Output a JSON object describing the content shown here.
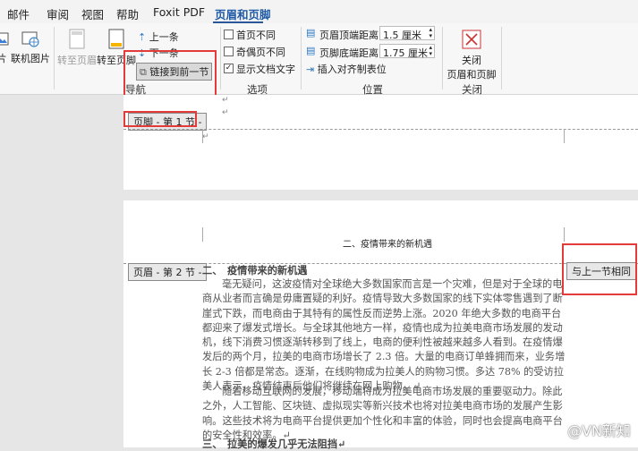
{
  "tabs": [
    "邮件",
    "审阅",
    "视图",
    "帮助",
    "Foxit PDF",
    "页眉和页脚"
  ],
  "ribbon": {
    "left_partial_1": "片",
    "left_partial_2": "联机图片",
    "goto_header": "转至页眉",
    "goto_footer": "转至页脚",
    "prev": "上一条",
    "next": "下一条",
    "link_prev": "链接到前一节",
    "group_nav": "导航",
    "opt_first_page": "首页不同",
    "opt_odd_even": "奇偶页不同",
    "opt_show_doc_text": "显示文档文字",
    "group_options": "选项",
    "header_top_label": "页眉顶端距离:",
    "header_top_value": "1.5 厘米",
    "footer_bottom_label": "页脚底端距离:",
    "footer_bottom_value": "1.75 厘米",
    "insert_align_tab": "插入对齐制表位",
    "group_position": "位置",
    "close_label_1": "关闭",
    "close_label_2": "页眉和页脚",
    "group_close": "关闭"
  },
  "page1": {
    "footer_tag": "页脚 - 第 1 节 -"
  },
  "page2": {
    "header_text": "二、疫情带来的新机遇",
    "header_tag": "页眉 - 第 2 节 -",
    "same_as_prev": "与上一节相同",
    "heading": "二、　疫情带来的新机遇",
    "p1": "毫无疑问，这波疫情对全球绝大多数国家而言是一个灾难，但是对于全球的电商从业者而言确是毋庸置疑的利好。疫情导致大多数国家的线下实体零售遇到了断崖式下跌，而电商由于其特有的属性反而逆势上涨。2020 年绝大多数的电商平台都迎来了爆发式增长。与全球其他地方一样，疫情也成为拉美电商市场发展的发动机，线下消费习惯逐渐转移到了线上，电商的便利性被越来越多人看到。在疫情爆发后的两个月，拉美的电商市场增长了 2.3 倍。大量的电商订单蜂拥而来，业务增长 2-3 倍都是常态。逐渐，在线购物成为拉美人的购物习惯。多达 78% 的受访拉美人表示，疫情结束后他们将继续在网上购物。↵",
    "p2": "随着移动互联网的发展，移动端将成为拉美电商市场发展的重要驱动力。除此之外，人工智能、区块链、虚拟现实等新兴技术也将对拉美电商市场的发展产生影响。这些技术将为电商平台提供更加个性化和丰富的体验，同时也会提高电商平台的安全性和效率。↵",
    "p3": "三、　拉美的爆发几乎无法阻挡↵"
  },
  "watermark": "@VN新知"
}
